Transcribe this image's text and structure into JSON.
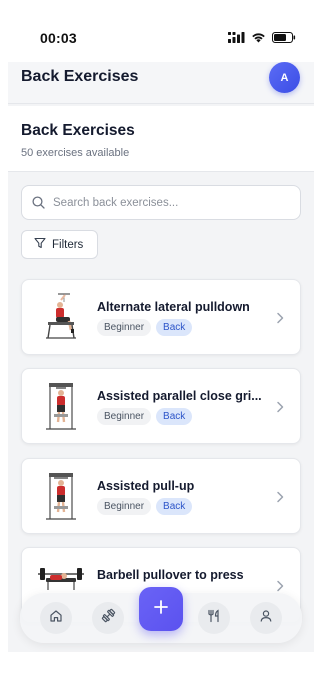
{
  "status_bar": {
    "time": "00:03"
  },
  "header": {
    "title": "Back Exercises",
    "avatar_initial": "A"
  },
  "section": {
    "title": "Back Exercises",
    "subtitle": "50 exercises available"
  },
  "search": {
    "placeholder": "Search back exercises...",
    "value": ""
  },
  "filters": {
    "label": "Filters"
  },
  "exercises": [
    {
      "name": "Alternate lateral pulldown",
      "level": "Beginner",
      "muscle": "Back"
    },
    {
      "name": "Assisted parallel close gri...",
      "level": "Beginner",
      "muscle": "Back"
    },
    {
      "name": "Assisted pull-up",
      "level": "Beginner",
      "muscle": "Back"
    },
    {
      "name": "Barbell pullover to press",
      "level": "",
      "muscle": ""
    }
  ],
  "bottom_nav": {
    "items": [
      "home-icon",
      "dumbbell-icon",
      "add-icon",
      "utensils-icon",
      "user-icon"
    ]
  },
  "colors": {
    "accent": "#5b52ef",
    "muscle_tag_bg": "#dbe6fb",
    "muscle_tag_text": "#2d55c9"
  }
}
